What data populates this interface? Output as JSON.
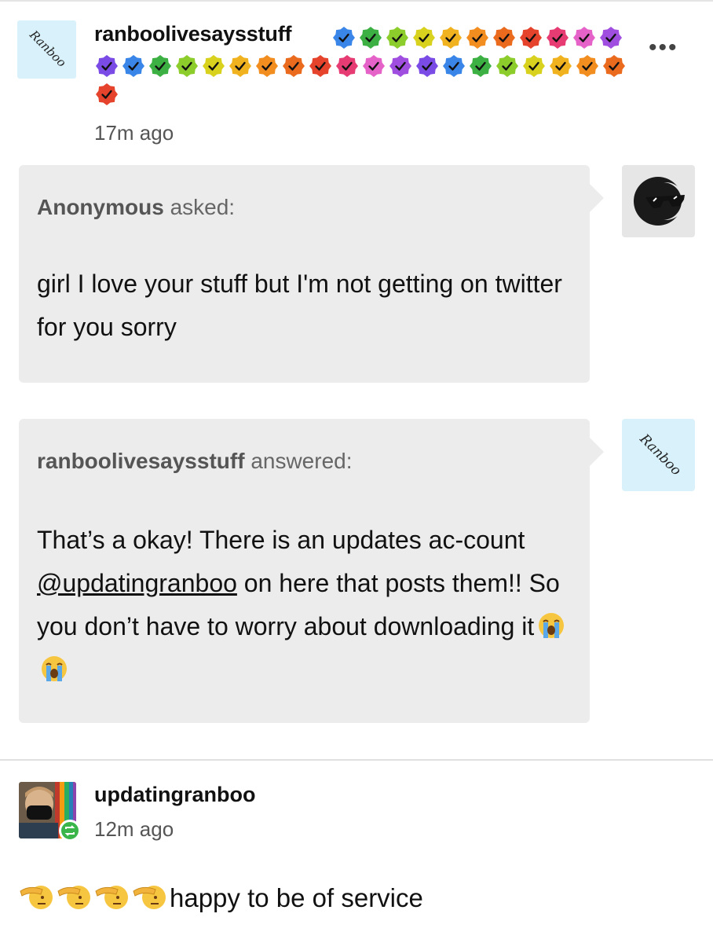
{
  "post": {
    "author": "ranboolivesaysstuff",
    "avatar_label": "Ranboo",
    "time": "17m ago",
    "badge_colors": [
      "#3a86e8",
      "#3cb043",
      "#8ccd2c",
      "#d8d21f",
      "#f0b21f",
      "#f28d1f",
      "#ea6a1e",
      "#e5432b",
      "#e63c73",
      "#e563c9",
      "#a04ee0",
      "#7b4be5",
      "#3a86e8",
      "#3cb043",
      "#8ccd2c",
      "#d8d21f",
      "#f0b21f",
      "#f28d1f",
      "#ea6a1e",
      "#e5432b",
      "#e63c73",
      "#e563c9",
      "#a04ee0",
      "#7b4be5",
      "#3a86e8",
      "#3cb043",
      "#8ccd2c",
      "#d8d21f",
      "#f0b21f",
      "#f28d1f",
      "#ea6a1e",
      "#e5432b"
    ],
    "more_label": "•••"
  },
  "ask": {
    "asker": "Anonymous",
    "verb": "asked:",
    "text": "girl I love your stuff but I'm not getting on twitter for you sorry",
    "avatar_icon": "anonymous-sunglasses-icon"
  },
  "answer": {
    "answerer": "ranboolivesaysstuff",
    "verb": "answered:",
    "text_before": "That’s a okay! There is an updates ac-count ",
    "mention": "@updatingranboo",
    "text_after": " on here that posts them!! So you don’t have to worry about downloading it",
    "avatar_label": "Ranboo",
    "emoji": "loudly-crying-face"
  },
  "reblog": {
    "author": "updatingranboo",
    "time": "12m ago",
    "text": "happy to be of service",
    "emoji": "saluting-face",
    "emoji_count": 4
  }
}
